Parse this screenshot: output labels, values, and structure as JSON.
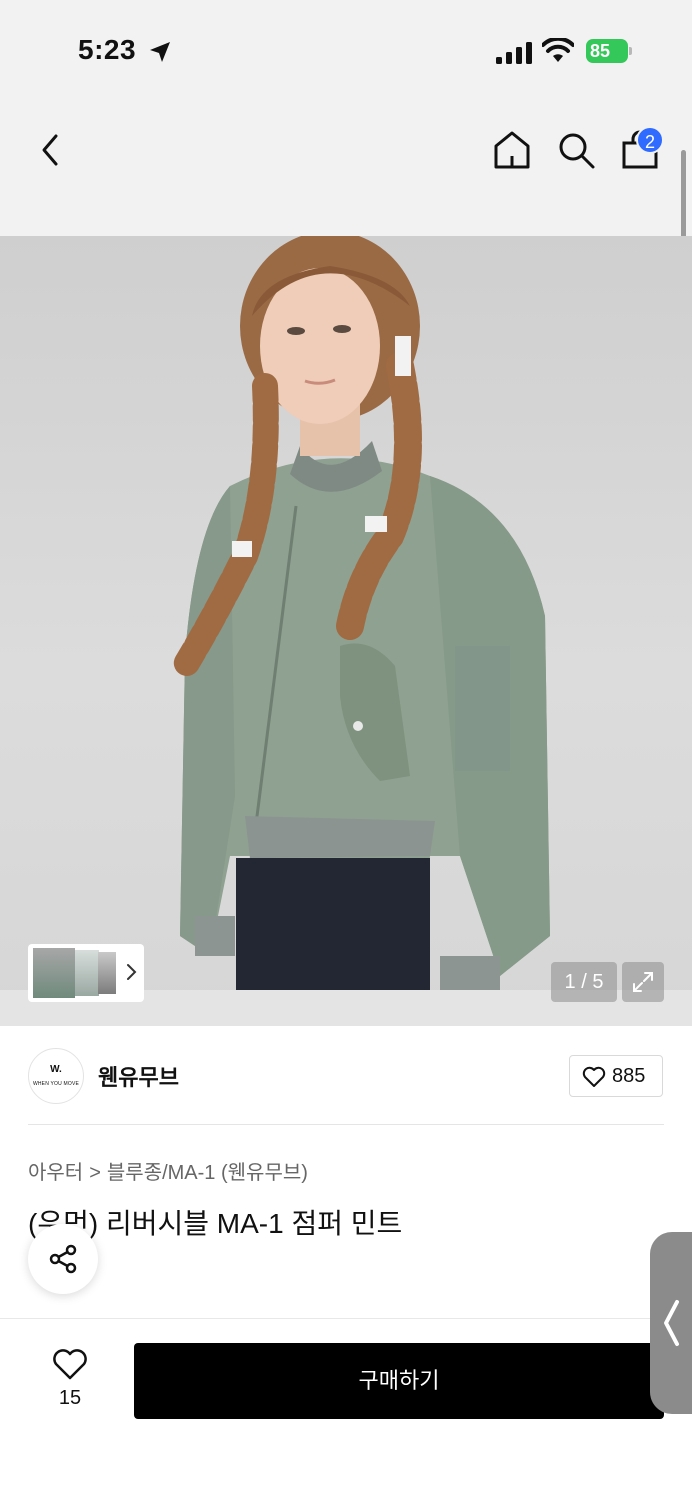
{
  "status_bar": {
    "time": "5:23",
    "battery": "85"
  },
  "nav": {
    "cart_count": "2"
  },
  "gallery": {
    "counter": "1 / 5"
  },
  "brand": {
    "logo_mark": "W.",
    "logo_text": "WHEN YOU MOVE",
    "name": "웬유무브",
    "like_count": "885"
  },
  "breadcrumb": {
    "category": "아우터",
    "separator": ">",
    "subcategory": "블루종/MA-1 (웬유무브)"
  },
  "product": {
    "title": "(우먼) 리버시블 MA-1 점퍼 민트"
  },
  "bottom": {
    "wish_count": "15",
    "buy_label": "구매하기"
  },
  "colors": {
    "badge": "#2f6bff",
    "battery": "#34c759",
    "buy_button": "#000000"
  }
}
